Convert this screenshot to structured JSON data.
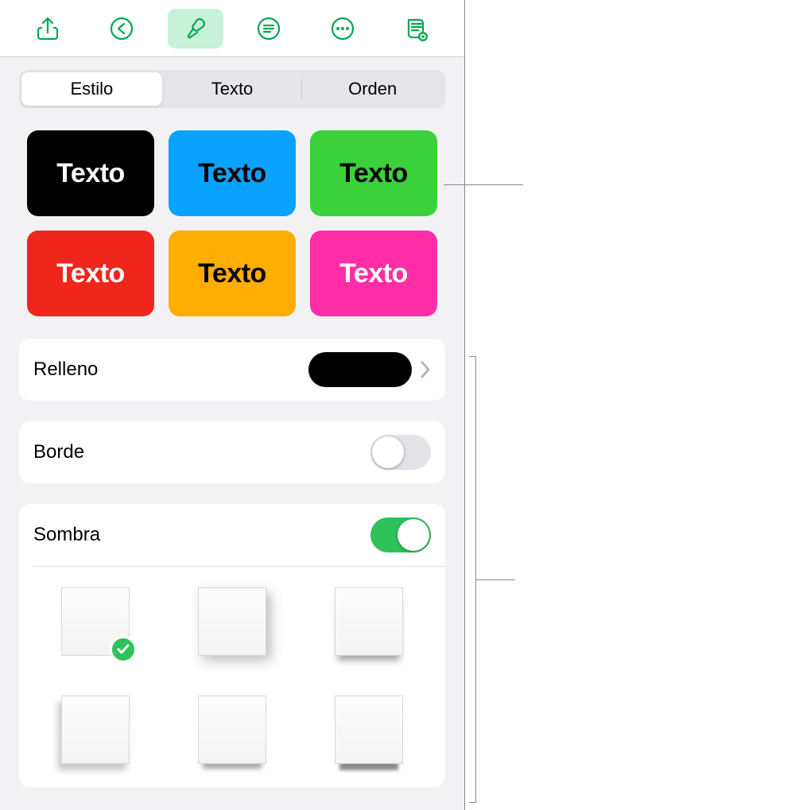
{
  "toolbar": {
    "share_icon": "share-icon",
    "undo_icon": "undo-icon",
    "format_icon": "format-brush-icon",
    "list_icon": "list-icon",
    "more_icon": "more-icon",
    "readmode_icon": "read-mode-icon"
  },
  "segmented": {
    "style": "Estilo",
    "text": "Texto",
    "order": "Orden"
  },
  "presets": [
    {
      "label": "Texto",
      "bg": "#000000",
      "fg": "#ffffff"
    },
    {
      "label": "Texto",
      "bg": "#0aa2ff",
      "fg": "#000000"
    },
    {
      "label": "Texto",
      "bg": "#3ad13a",
      "fg": "#000000"
    },
    {
      "label": "Texto",
      "bg": "#f0261c",
      "fg": "#ffffff"
    },
    {
      "label": "Texto",
      "bg": "#ffad00",
      "fg": "#000000"
    },
    {
      "label": "Texto",
      "bg": "#ff2ea6",
      "fg": "#ffffff"
    }
  ],
  "rows": {
    "fill": {
      "label": "Relleno",
      "swatch": "#000000"
    },
    "border": {
      "label": "Borde",
      "on": false
    },
    "shadow": {
      "label": "Sombra",
      "on": true
    }
  },
  "shadow_selected_index": 0
}
